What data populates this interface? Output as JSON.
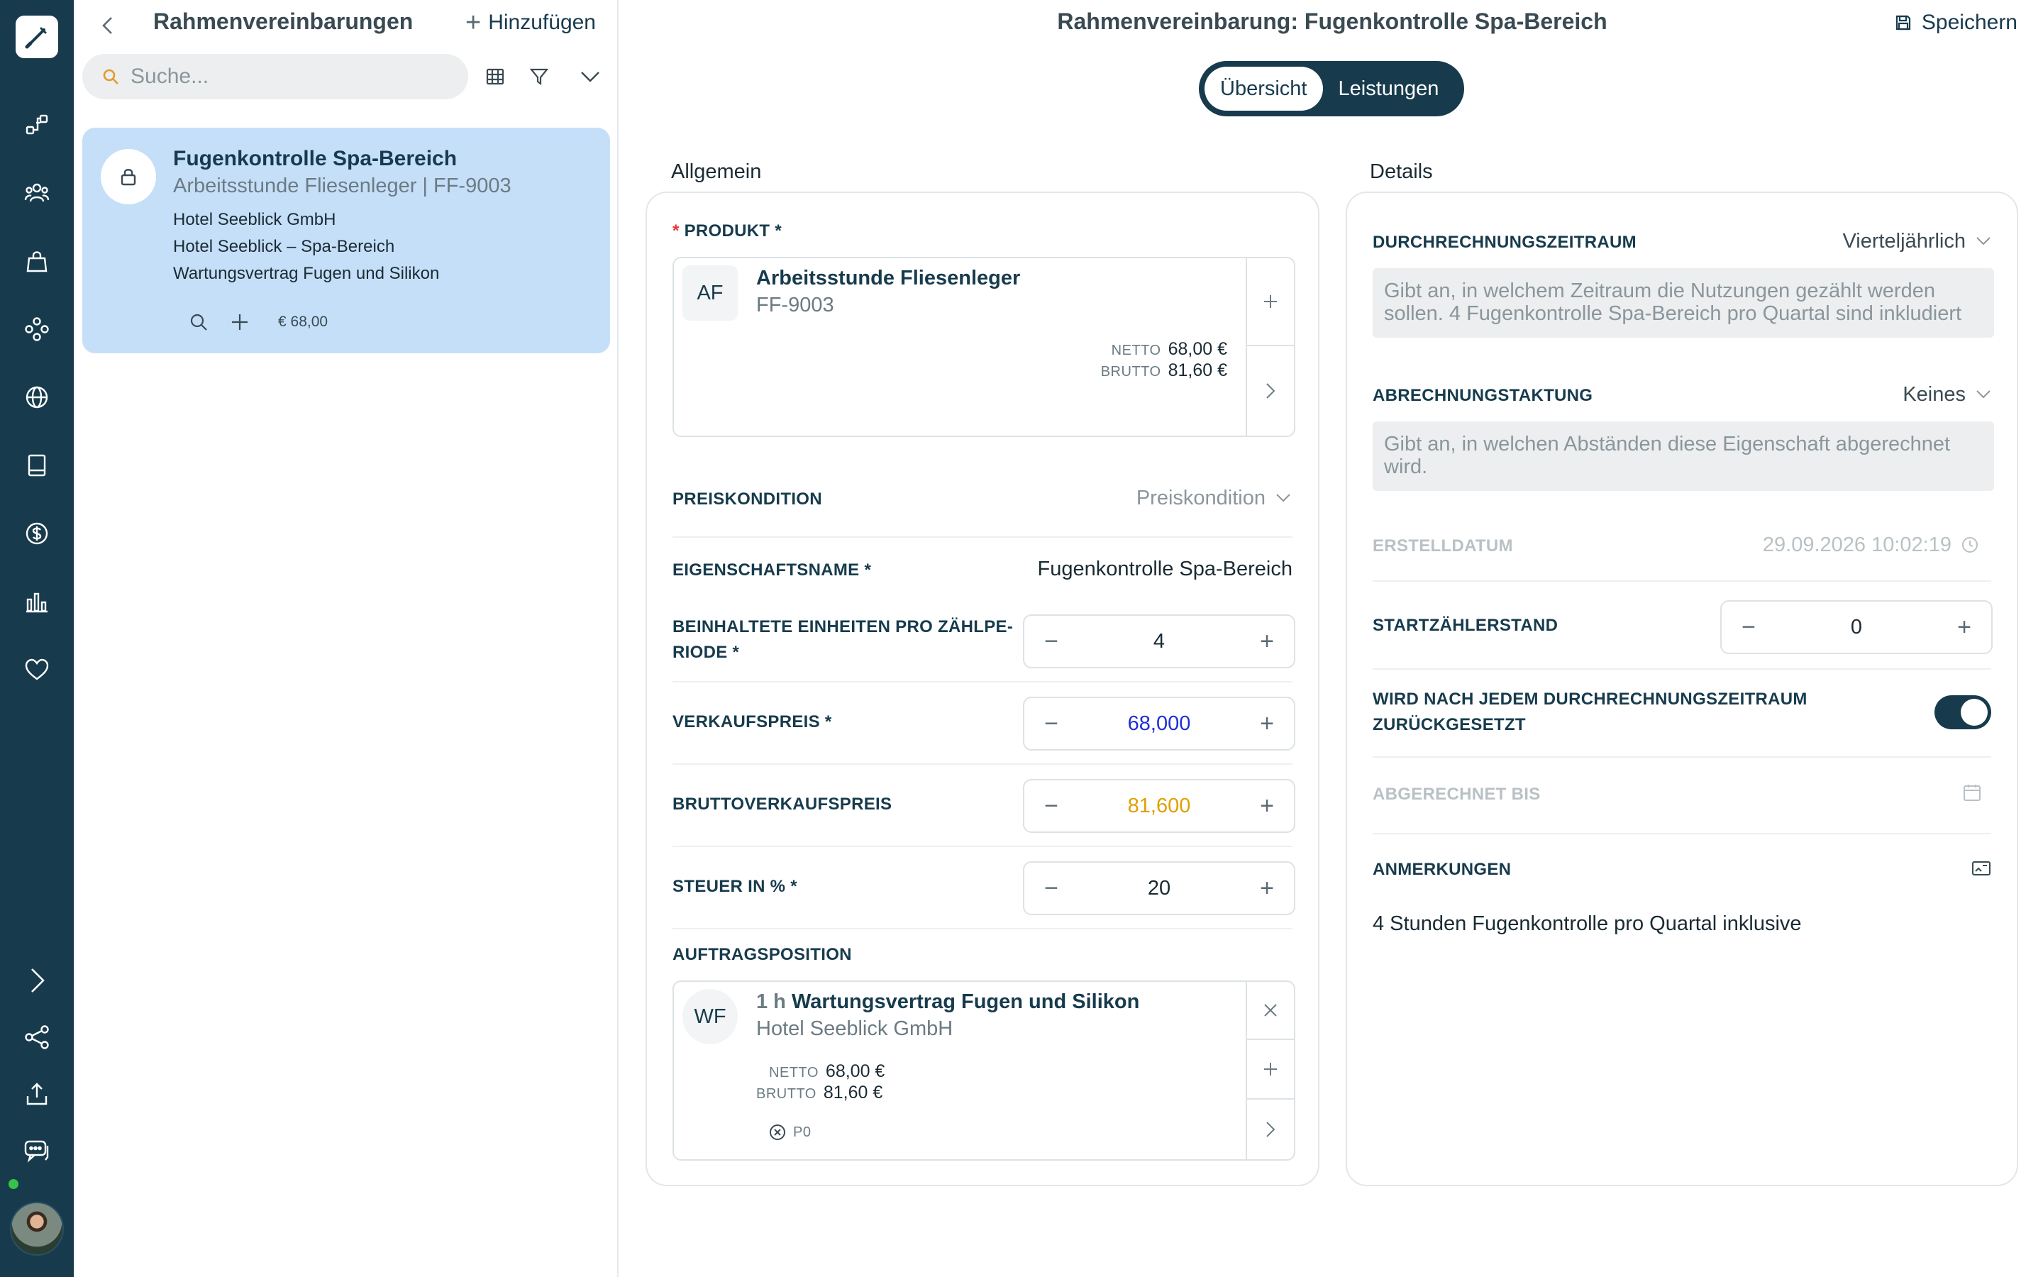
{
  "rail": {
    "items": [
      "logo-icon",
      "flow-icon",
      "people-icon",
      "bag-icon",
      "modules-icon",
      "globe-icon",
      "book-icon",
      "dollar-icon",
      "chart-icon",
      "heart-icon",
      "expand-icon",
      "share-icon",
      "upload-icon",
      "chat-icon"
    ]
  },
  "list": {
    "title": "Rahmenvereinbarungen",
    "add_label": "Hinzufügen",
    "search_placeholder": "Suche...",
    "item": {
      "title": "Fugenkontrolle Spa-Bereich",
      "subtitle": "Arbeitsstunde Fliesenleger | FF-9003",
      "lines": [
        "Hotel Seeblick GmbH",
        "Hotel Seeblick – Spa-Bereich",
        "Wartungsvertrag Fugen und Silikon"
      ],
      "price": "€ 68,00"
    }
  },
  "main": {
    "title": "Rahmenvereinbarung: Fugenkontrolle Spa-Bereich",
    "save_label": "Speichern",
    "tabs": [
      {
        "label": "Übersicht",
        "active": true
      },
      {
        "label": "Leistungen",
        "active": false
      }
    ]
  },
  "general": {
    "section_title": "Allgemein",
    "product": {
      "label": "PRODUKT *",
      "required_mark": "*",
      "initials": "AF",
      "name": "Arbeitsstunde Fliesenleger",
      "code": "FF-9003",
      "netto_label": "NETTO",
      "netto": "68,00 €",
      "brutto_label": "BRUTTO",
      "brutto": "81,60 €"
    },
    "price_condition": {
      "label": "PREISKONDITION",
      "placeholder": "Preiskondition"
    },
    "property_name": {
      "label": "EIGENSCHAFTSNAME *",
      "value": "Fugenkontrolle Spa-Bereich"
    },
    "units": {
      "label_line1": "BEINHALTETE EINHEITEN PRO ZÄHLPE-",
      "label_line2": "RIODE *",
      "value": "4"
    },
    "sale_price": {
      "label": "VERKAUFSPREIS *",
      "value": "68,000",
      "color": "#1f2fd6"
    },
    "gross_price": {
      "label": "BRUTTOVERKAUFSPREIS",
      "value": "81,600",
      "color": "#e0a000"
    },
    "tax": {
      "label": "STEUER IN % *",
      "value": "20"
    },
    "order_position": {
      "label": "AUFTRAGSPOSITION",
      "initials": "WF",
      "qty": "1 h",
      "name": "Wartungsvertrag Fugen und Silikon",
      "customer": "Hotel Seeblick GmbH",
      "netto_label": "NETTO",
      "netto": "68,00 €",
      "brutto_label": "BRUTTO",
      "brutto": "81,60 €",
      "tag": "P0"
    }
  },
  "details": {
    "section_title": "Details",
    "billing_period": {
      "label": "DURCHRECHNUNGSZEITRAUM",
      "value": "Vierteljährlich",
      "hint": "Gibt an, in welchem Zeitraum die Nutzungen gezählt werden sollen. 4 Fugenkontrolle Spa-Bereich pro Quartal sind inkludiert"
    },
    "billing_cycle": {
      "label": "ABRECHNUNGSTAKTUNG",
      "value": "Keines",
      "hint": "Gibt an, in welchen Abständen diese Eigenschaft abgerechnet wird."
    },
    "created": {
      "label": "ERSTELLDATUM",
      "value": "29.09.2026 10:02:19"
    },
    "start_counter": {
      "label": "STARTZÄHLERSTAND",
      "value": "0"
    },
    "reset": {
      "label_line1": "WIRD NACH JEDEM DURCHRECHNUNGSZEITRAUM",
      "label_line2": "ZURÜCKGESETZT",
      "on": true
    },
    "billed_until": {
      "label": "ABGERECHNET BIS"
    },
    "notes": {
      "label": "ANMERKUNGEN",
      "value": "4 Stunden Fugenkontrolle pro Quartal inklusive"
    }
  }
}
